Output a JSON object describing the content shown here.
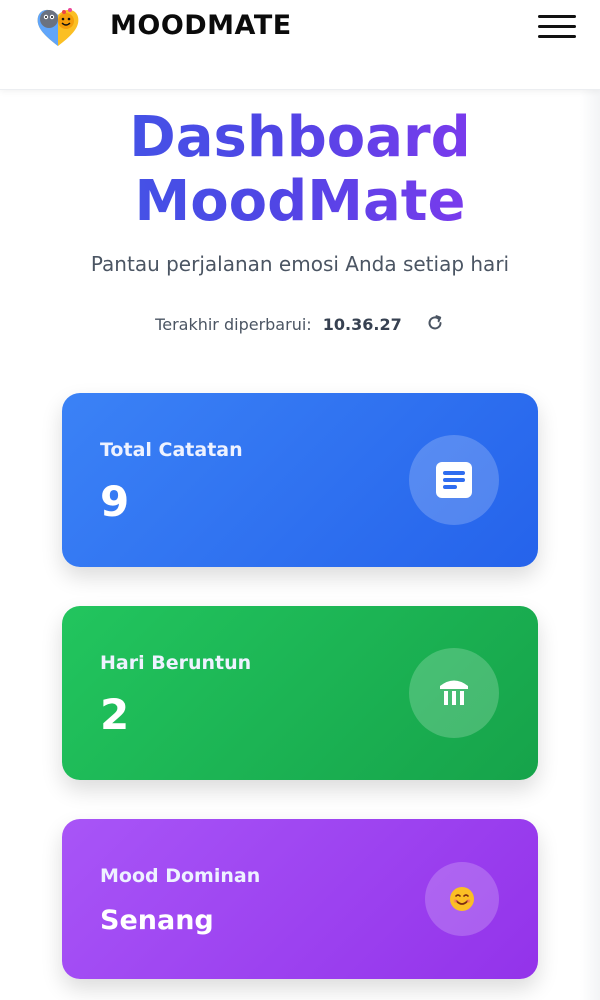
{
  "header": {
    "brand": "MOODMATE",
    "logo_icon": "moodmate-logo-icon",
    "menu_icon": "hamburger-menu-icon"
  },
  "hero": {
    "title_line1": "Dashboard",
    "title_line2": "MoodMate",
    "subtitle": "Pantau perjalanan emosi Anda setiap hari",
    "updated_label": "Terakhir diperbarui:",
    "updated_time": "10.36.27",
    "refresh_icon": "refresh-icon"
  },
  "cards": [
    {
      "label": "Total Catatan",
      "value": "9",
      "icon": "document-icon",
      "color": "#3b82f6"
    },
    {
      "label": "Hari Beruntun",
      "value": "2",
      "icon": "landmark-icon",
      "color": "#22c55e"
    },
    {
      "label": "Mood Dominan",
      "value": "Senang",
      "icon": "smiling-face-icon",
      "color": "#a855f7"
    }
  ],
  "colors": {
    "title_gradient_start": "#3b5de7",
    "title_gradient_end": "#9333ea",
    "text_muted": "#4b5563"
  }
}
